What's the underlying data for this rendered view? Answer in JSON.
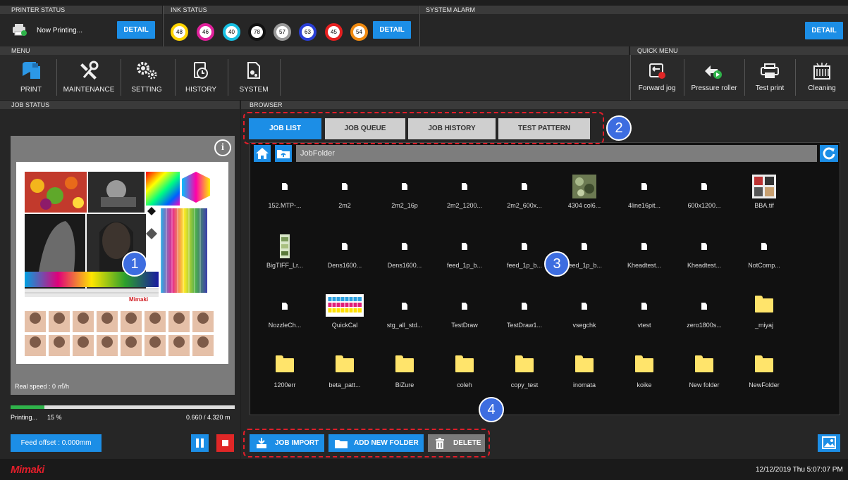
{
  "printer_status": {
    "header": "PRINTER STATUS",
    "status_text": "Now Printing...",
    "detail_label": "DETAIL"
  },
  "ink_status": {
    "header": "INK STATUS",
    "detail_label": "DETAIL",
    "inks": [
      {
        "value": "48",
        "color": "#ffd400"
      },
      {
        "value": "46",
        "color": "#e0219b"
      },
      {
        "value": "40",
        "color": "#17c0e3"
      },
      {
        "value": "78",
        "color": "#111111"
      },
      {
        "value": "57",
        "color": "#9a9a9a"
      },
      {
        "value": "63",
        "color": "#2a3fd6"
      },
      {
        "value": "45",
        "color": "#e62020"
      },
      {
        "value": "54",
        "color": "#f08a10"
      }
    ]
  },
  "system_alarm": {
    "header": "SYSTEM ALARM",
    "detail_label": "DETAIL"
  },
  "menu": {
    "header": "MENU",
    "items": [
      {
        "label": "PRINT",
        "icon": "print-icon"
      },
      {
        "label": "MAINTENANCE",
        "icon": "maintenance-icon"
      },
      {
        "label": "SETTING",
        "icon": "setting-icon"
      },
      {
        "label": "HISTORY",
        "icon": "history-icon"
      },
      {
        "label": "SYSTEM",
        "icon": "system-icon"
      }
    ]
  },
  "quick_menu": {
    "header": "QUICK MENU",
    "items": [
      {
        "label": "Forward jog",
        "icon": "forward-jog-icon"
      },
      {
        "label": "Pressure roller",
        "icon": "pressure-roller-icon"
      },
      {
        "label": "Test print",
        "icon": "test-print-icon"
      },
      {
        "label": "Cleaning",
        "icon": "cleaning-icon"
      }
    ]
  },
  "job_status": {
    "header": "JOB STATUS",
    "real_speed": "Real speed : 0 ㎡/h",
    "progress_label": "Printing...",
    "progress_percent": "15 %",
    "progress_value": 0.15,
    "length": "0.660 / 4.320 m",
    "feed_offset_label": "Feed offset : 0.000mm",
    "preview_brand": "Mimaki"
  },
  "browser": {
    "header": "BROWSER",
    "tabs": [
      {
        "label": "JOB LIST",
        "active": true
      },
      {
        "label": "JOB QUEUE"
      },
      {
        "label": "JOB HISTORY"
      },
      {
        "label": "TEST PATTERN"
      }
    ],
    "path": "JobFolder",
    "files": [
      {
        "name": "152.MTP-...",
        "type": "doc"
      },
      {
        "name": "2m2",
        "type": "doc"
      },
      {
        "name": "2m2_16p",
        "type": "doc"
      },
      {
        "name": "2m2_1200...",
        "type": "doc"
      },
      {
        "name": "2m2_600x...",
        "type": "doc"
      },
      {
        "name": "4304 col6...",
        "type": "image"
      },
      {
        "name": "4line16pit...",
        "type": "doc"
      },
      {
        "name": "600x1200...",
        "type": "doc"
      },
      {
        "name": "BBA.tif",
        "type": "image"
      },
      {
        "name": "BigTIFF_Lr...",
        "type": "image"
      },
      {
        "name": "Dens1600...",
        "type": "doc"
      },
      {
        "name": "Dens1600...",
        "type": "doc"
      },
      {
        "name": "feed_1p_b...",
        "type": "doc"
      },
      {
        "name": "feed_1p_b...",
        "type": "doc"
      },
      {
        "name": "feed_1p_b...",
        "type": "doc"
      },
      {
        "name": "Kheadtest...",
        "type": "doc"
      },
      {
        "name": "Kheadtest...",
        "type": "doc"
      },
      {
        "name": "NotComp...",
        "type": "doc"
      },
      {
        "name": "NozzleCh...",
        "type": "doc"
      },
      {
        "name": "QuickCal",
        "type": "image"
      },
      {
        "name": "stg_all_std...",
        "type": "doc"
      },
      {
        "name": "TestDraw",
        "type": "doc"
      },
      {
        "name": "TestDraw1...",
        "type": "doc"
      },
      {
        "name": "vsegchk",
        "type": "doc"
      },
      {
        "name": "vtest",
        "type": "doc"
      },
      {
        "name": "zero1800s...",
        "type": "doc"
      },
      {
        "name": "_miyaj",
        "type": "folder"
      },
      {
        "name": "1200err",
        "type": "folder"
      },
      {
        "name": "beta_patt...",
        "type": "folder"
      },
      {
        "name": "BiZure",
        "type": "folder"
      },
      {
        "name": "coleh",
        "type": "folder"
      },
      {
        "name": "copy_test",
        "type": "folder"
      },
      {
        "name": "inomata",
        "type": "folder"
      },
      {
        "name": "koike",
        "type": "folder"
      },
      {
        "name": "New folder",
        "type": "folder"
      },
      {
        "name": "NewFolder",
        "type": "folder"
      }
    ],
    "buttons": {
      "job_import": "JOB IMPORT",
      "add_new_folder": "ADD NEW FOLDER",
      "delete": "DELETE"
    }
  },
  "footer": {
    "brand": "Mimaki",
    "datetime": "12/12/2019 Thu 5:07:07 PM"
  },
  "callouts": [
    "1",
    "2",
    "3",
    "4"
  ]
}
